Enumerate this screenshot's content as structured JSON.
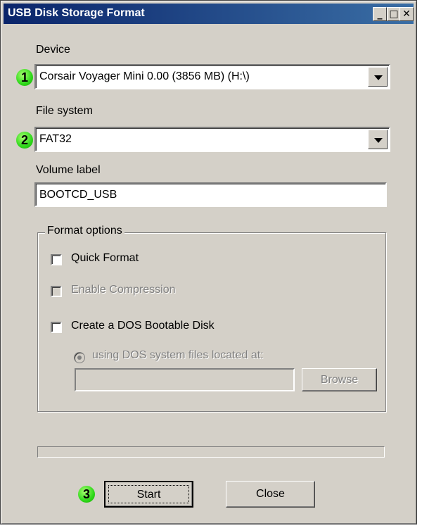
{
  "window": {
    "title": "USB Disk Storage Format",
    "controls": {
      "minimize": "_",
      "maximize": "□",
      "close": "✕"
    }
  },
  "device": {
    "label": "Device",
    "badge": "1",
    "value": "Corsair Voyager Mini 0.00 (3856 MB) (H:\\)"
  },
  "file_system": {
    "label": "File system",
    "badge": "2",
    "value": "FAT32"
  },
  "volume_label": {
    "label": "Volume label",
    "value": "BOOTCD_USB"
  },
  "format_options": {
    "title": "Format options",
    "quick_format": {
      "label": "Quick Format",
      "checked": false,
      "enabled": true
    },
    "enable_compression": {
      "label": "Enable Compression",
      "checked": false,
      "enabled": false
    },
    "dos_bootable": {
      "label": "Create a DOS Bootable Disk",
      "checked": false,
      "enabled": true
    },
    "dos_files_radio": {
      "label": "using DOS system files located at:",
      "enabled": false
    },
    "path_value": "",
    "browse_label": "Browse"
  },
  "progress": {
    "value": 0
  },
  "actions": {
    "start_badge": "3",
    "start_label": "Start",
    "close_label": "Close"
  },
  "colors": {
    "titlebar": "#0a246a",
    "face": "#d4d0c8",
    "badge": "#2ed81a"
  }
}
